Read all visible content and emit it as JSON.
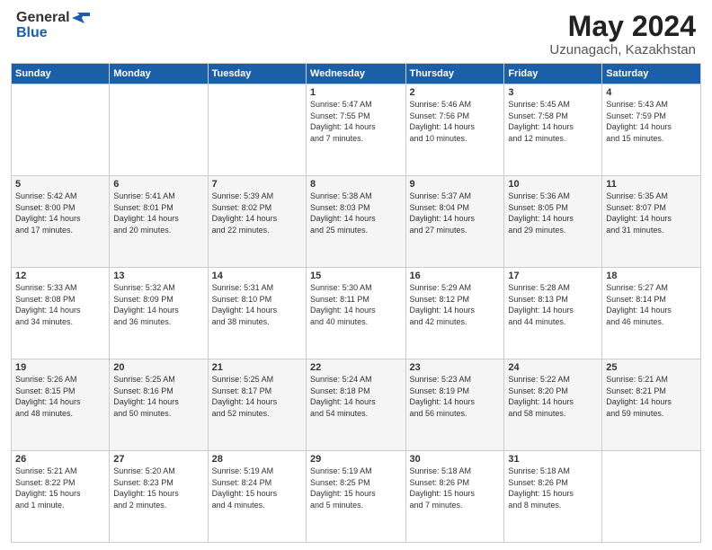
{
  "header": {
    "logo_line1": "General",
    "logo_line2": "Blue",
    "title": "May 2024",
    "subtitle": "Uzunagach, Kazakhstan"
  },
  "days_of_week": [
    "Sunday",
    "Monday",
    "Tuesday",
    "Wednesday",
    "Thursday",
    "Friday",
    "Saturday"
  ],
  "weeks": [
    [
      {
        "day": "",
        "info": ""
      },
      {
        "day": "",
        "info": ""
      },
      {
        "day": "",
        "info": ""
      },
      {
        "day": "1",
        "info": "Sunrise: 5:47 AM\nSunset: 7:55 PM\nDaylight: 14 hours\nand 7 minutes."
      },
      {
        "day": "2",
        "info": "Sunrise: 5:46 AM\nSunset: 7:56 PM\nDaylight: 14 hours\nand 10 minutes."
      },
      {
        "day": "3",
        "info": "Sunrise: 5:45 AM\nSunset: 7:58 PM\nDaylight: 14 hours\nand 12 minutes."
      },
      {
        "day": "4",
        "info": "Sunrise: 5:43 AM\nSunset: 7:59 PM\nDaylight: 14 hours\nand 15 minutes."
      }
    ],
    [
      {
        "day": "5",
        "info": "Sunrise: 5:42 AM\nSunset: 8:00 PM\nDaylight: 14 hours\nand 17 minutes."
      },
      {
        "day": "6",
        "info": "Sunrise: 5:41 AM\nSunset: 8:01 PM\nDaylight: 14 hours\nand 20 minutes."
      },
      {
        "day": "7",
        "info": "Sunrise: 5:39 AM\nSunset: 8:02 PM\nDaylight: 14 hours\nand 22 minutes."
      },
      {
        "day": "8",
        "info": "Sunrise: 5:38 AM\nSunset: 8:03 PM\nDaylight: 14 hours\nand 25 minutes."
      },
      {
        "day": "9",
        "info": "Sunrise: 5:37 AM\nSunset: 8:04 PM\nDaylight: 14 hours\nand 27 minutes."
      },
      {
        "day": "10",
        "info": "Sunrise: 5:36 AM\nSunset: 8:05 PM\nDaylight: 14 hours\nand 29 minutes."
      },
      {
        "day": "11",
        "info": "Sunrise: 5:35 AM\nSunset: 8:07 PM\nDaylight: 14 hours\nand 31 minutes."
      }
    ],
    [
      {
        "day": "12",
        "info": "Sunrise: 5:33 AM\nSunset: 8:08 PM\nDaylight: 14 hours\nand 34 minutes."
      },
      {
        "day": "13",
        "info": "Sunrise: 5:32 AM\nSunset: 8:09 PM\nDaylight: 14 hours\nand 36 minutes."
      },
      {
        "day": "14",
        "info": "Sunrise: 5:31 AM\nSunset: 8:10 PM\nDaylight: 14 hours\nand 38 minutes."
      },
      {
        "day": "15",
        "info": "Sunrise: 5:30 AM\nSunset: 8:11 PM\nDaylight: 14 hours\nand 40 minutes."
      },
      {
        "day": "16",
        "info": "Sunrise: 5:29 AM\nSunset: 8:12 PM\nDaylight: 14 hours\nand 42 minutes."
      },
      {
        "day": "17",
        "info": "Sunrise: 5:28 AM\nSunset: 8:13 PM\nDaylight: 14 hours\nand 44 minutes."
      },
      {
        "day": "18",
        "info": "Sunrise: 5:27 AM\nSunset: 8:14 PM\nDaylight: 14 hours\nand 46 minutes."
      }
    ],
    [
      {
        "day": "19",
        "info": "Sunrise: 5:26 AM\nSunset: 8:15 PM\nDaylight: 14 hours\nand 48 minutes."
      },
      {
        "day": "20",
        "info": "Sunrise: 5:25 AM\nSunset: 8:16 PM\nDaylight: 14 hours\nand 50 minutes."
      },
      {
        "day": "21",
        "info": "Sunrise: 5:25 AM\nSunset: 8:17 PM\nDaylight: 14 hours\nand 52 minutes."
      },
      {
        "day": "22",
        "info": "Sunrise: 5:24 AM\nSunset: 8:18 PM\nDaylight: 14 hours\nand 54 minutes."
      },
      {
        "day": "23",
        "info": "Sunrise: 5:23 AM\nSunset: 8:19 PM\nDaylight: 14 hours\nand 56 minutes."
      },
      {
        "day": "24",
        "info": "Sunrise: 5:22 AM\nSunset: 8:20 PM\nDaylight: 14 hours\nand 58 minutes."
      },
      {
        "day": "25",
        "info": "Sunrise: 5:21 AM\nSunset: 8:21 PM\nDaylight: 14 hours\nand 59 minutes."
      }
    ],
    [
      {
        "day": "26",
        "info": "Sunrise: 5:21 AM\nSunset: 8:22 PM\nDaylight: 15 hours\nand 1 minute."
      },
      {
        "day": "27",
        "info": "Sunrise: 5:20 AM\nSunset: 8:23 PM\nDaylight: 15 hours\nand 2 minutes."
      },
      {
        "day": "28",
        "info": "Sunrise: 5:19 AM\nSunset: 8:24 PM\nDaylight: 15 hours\nand 4 minutes."
      },
      {
        "day": "29",
        "info": "Sunrise: 5:19 AM\nSunset: 8:25 PM\nDaylight: 15 hours\nand 5 minutes."
      },
      {
        "day": "30",
        "info": "Sunrise: 5:18 AM\nSunset: 8:26 PM\nDaylight: 15 hours\nand 7 minutes."
      },
      {
        "day": "31",
        "info": "Sunrise: 5:18 AM\nSunset: 8:26 PM\nDaylight: 15 hours\nand 8 minutes."
      },
      {
        "day": "",
        "info": ""
      }
    ]
  ]
}
